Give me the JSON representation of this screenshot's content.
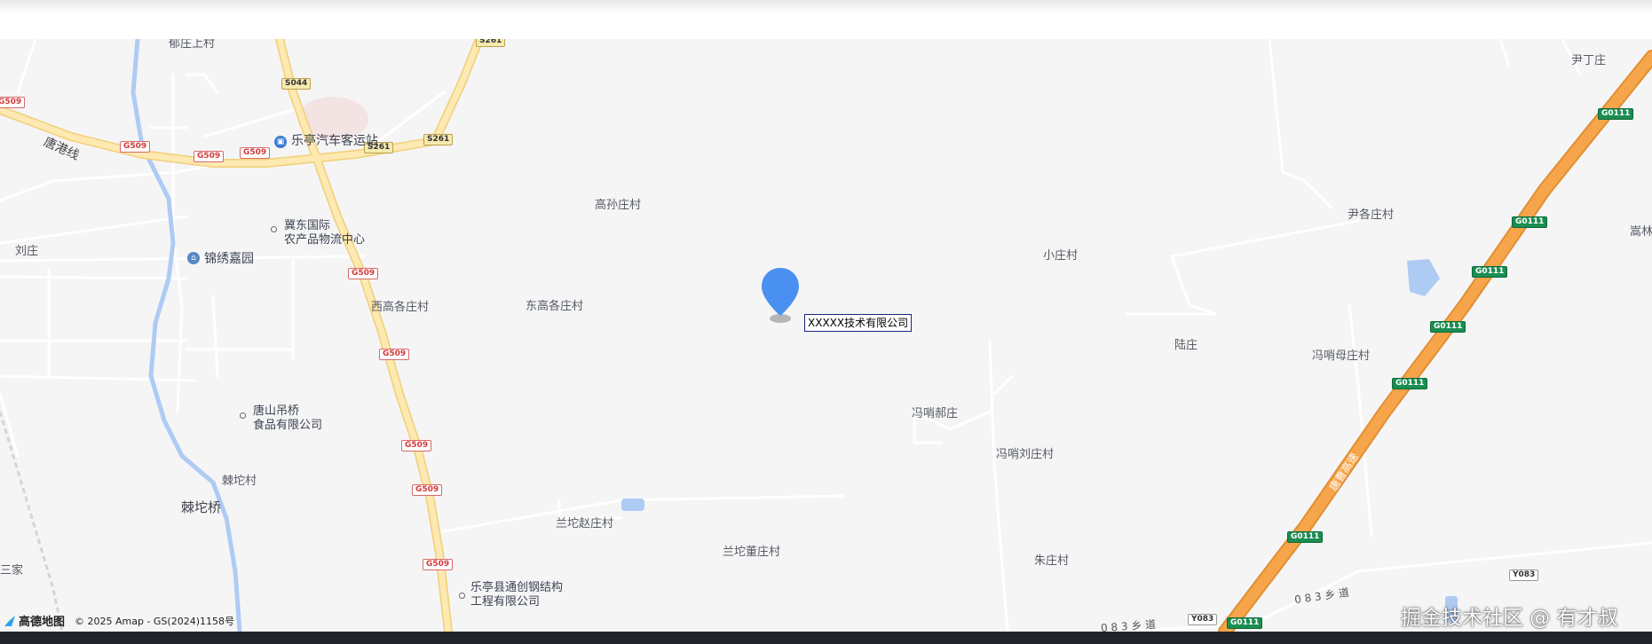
{
  "map": {
    "places": {
      "yu_zhuang_shang": "郁庄上村",
      "yin_ding_zhuang": "尹丁庄",
      "tang_gang_xian": "唐港线",
      "letting_bus_station": "乐亭汽车客运站",
      "gao_sun_zhuang": "高孙庄村",
      "yin_ge_zhuang": "尹各庄村",
      "song_lin": "嵩林",
      "jidong_line1": "冀东国际",
      "jidong_line2": "农产品物流中心",
      "liu_zhuang": "刘庄",
      "xiao_zhuang": "小庄村",
      "jinxiu_jiayuan": "锦绣嘉园",
      "xi_gao_ge_zhuang": "西高各庄村",
      "dong_gao_ge_zhuang": "东高各庄村",
      "lu_zhuang": "陆庄",
      "feng_shao_mu_zhuang": "冯哨母庄村",
      "tangshan_diaoqiao_line1": "唐山吊桥",
      "tangshan_diaoqiao_line2": "食品有限公司",
      "feng_shao_hao_zhuang": "冯哨郝庄",
      "feng_shao_liu_zhuang": "冯哨刘庄村",
      "la_tuo_cun": "棘坨村",
      "la_tuo_qiao": "棘坨桥",
      "lan_tuo_zhao_zhuang": "兰坨赵庄村",
      "lan_tuo_dong_zhuang": "兰坨董庄村",
      "zhu_zhuang": "朱庄村",
      "san_jia": "三家",
      "tongchuang_line1": "乐亭县通创钢结构",
      "tongchuang_line2": "工程有限公司",
      "expressway_name": "唐曹高速",
      "y083_road_name1": "0 8 3 乡 道",
      "y083_road_name2": "0 8 3 乡 道"
    },
    "shields": {
      "s261_a": "S261",
      "s261_b": "S261",
      "s261_c": "S261",
      "s044": "S044",
      "g509_a": "G509",
      "g509_b": "G509",
      "g509_c": "G509",
      "g509_d": "G509",
      "g509_e": "G509",
      "g509_f": "G509",
      "g509_g": "G509",
      "g509_h": "G509",
      "g509_i": "G509",
      "g0111_a": "G0111",
      "g0111_b": "G0111",
      "g0111_c": "G0111",
      "g0111_d": "G0111",
      "g0111_e": "G0111",
      "g0111_f": "G0111",
      "g0111_g": "G0111",
      "y083_a": "Y083",
      "y083_b": "Y083"
    },
    "marker": {
      "label": "XXXXX技术有限公司",
      "icon": "map-pin-icon",
      "color": "#4a90f0"
    },
    "attribution": {
      "logo": "高德地图",
      "copyright": "© 2025 Amap - GS(2024)1158号"
    },
    "watermark": "掘金技术社区 @ 有才叔",
    "colors": {
      "expressway": "#f7a54a",
      "provincial_road": "#fde4a0",
      "river": "#aecbf3",
      "background": "#f5f5f6"
    }
  }
}
